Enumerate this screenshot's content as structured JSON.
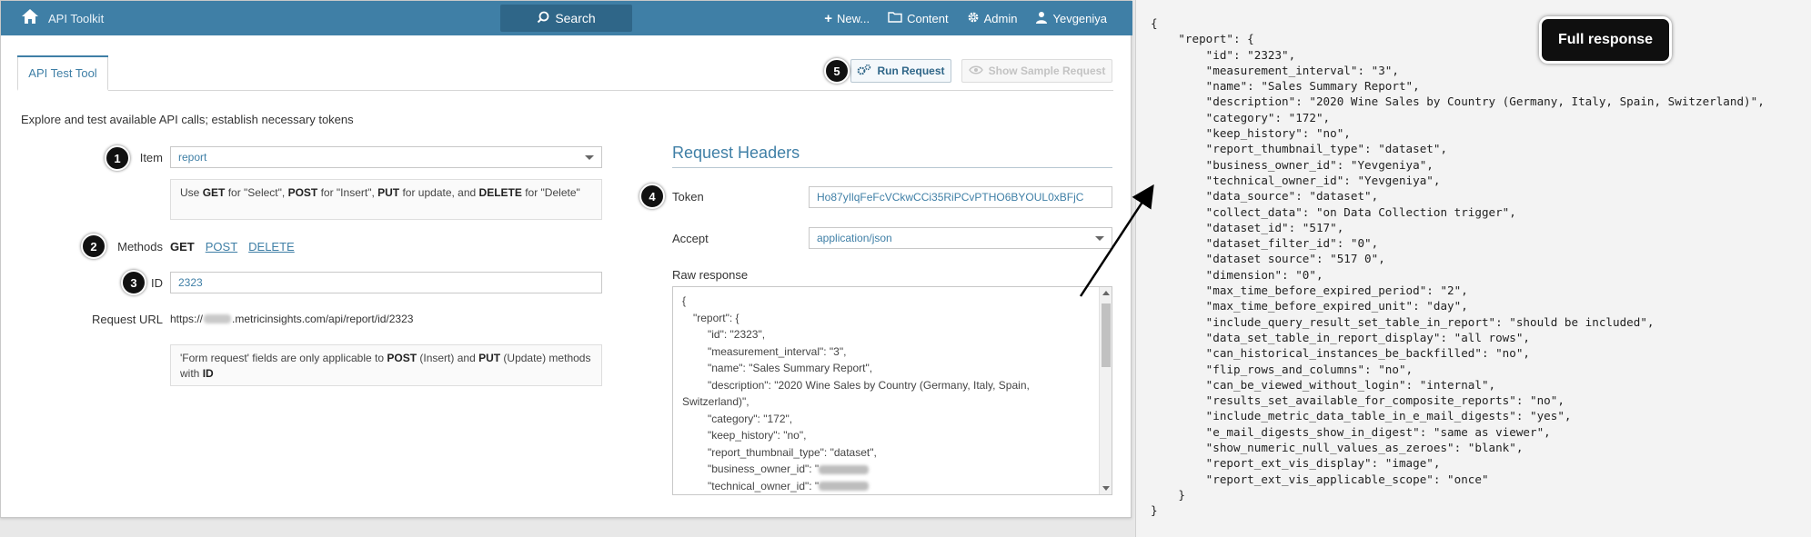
{
  "topbar": {
    "title": "API Toolkit",
    "search_label": "Search",
    "nav": [
      {
        "label": "New..."
      },
      {
        "label": "Content"
      },
      {
        "label": "Admin"
      },
      {
        "label": "Yevgeniya"
      }
    ]
  },
  "tab": {
    "label": "API Test Tool"
  },
  "actions": {
    "run_label": "Run Request",
    "sample_label": "Show Sample Request"
  },
  "intro": "Explore and test available API calls; establish necessary tokens",
  "form": {
    "item_label": "Item",
    "item_value": "report",
    "item_hint_parts": [
      "Use ",
      "GET",
      " for \"Select\", ",
      "POST",
      " for \"Insert\", ",
      "PUT",
      " for update, and ",
      "DELETE",
      " for \"Delete\""
    ],
    "methods_label": "Methods",
    "methods": [
      {
        "label": "GET",
        "active": true
      },
      {
        "label": "POST",
        "active": false
      },
      {
        "label": "DELETE",
        "active": false
      }
    ],
    "id_label": "ID",
    "id_value": "2323",
    "url_label": "Request URL",
    "url_prefix": "https://",
    "url_suffix": ".metricinsights.com/api/report/id/2323",
    "form_hint_parts": [
      "'Form request' fields are only applicable to ",
      "POST",
      " (Insert) and ",
      "PUT",
      " (Update) methods with ",
      "ID"
    ]
  },
  "headers": {
    "title": "Request Headers",
    "token_label": "Token",
    "token_value": "Ho87yIlqFeFcVCkwCCi35RiPCvPTHO6BYOUL0xBFjC",
    "accept_label": "Accept",
    "accept_value": "application/json",
    "raw_label": "Raw response"
  },
  "raw_response": [
    "{",
    "\"report\": {",
    "\"id\": \"2323\",",
    "\"measurement_interval\": \"3\",",
    "\"name\": \"Sales Summary Report\",",
    "\"description\": \"2020 Wine Sales by Country (Germany, Italy, Spain,",
    "Switzerland)\",",
    "\"category\": \"172\",",
    "\"keep_history\": \"no\",",
    "\"report_thumbnail_type\": \"dataset\",",
    "\"business_owner_id\": \"",
    "\"technical_owner_id\": \""
  ],
  "badges": [
    "1",
    "2",
    "3",
    "4",
    "5"
  ],
  "full_response_label": "Full response",
  "full_response_lines": [
    "{",
    "    \"report\": {",
    "        \"id\": \"2323\",",
    "        \"measurement_interval\": \"3\",",
    "        \"name\": \"Sales Summary Report\",",
    "        \"description\": \"2020 Wine Sales by Country (Germany, Italy, Spain, Switzerland)\",",
    "        \"category\": \"172\",",
    "        \"keep_history\": \"no\",",
    "        \"report_thumbnail_type\": \"dataset\",",
    "        \"business_owner_id\": \"Yevgeniya\",",
    "        \"technical_owner_id\": \"Yevgeniya\",",
    "        \"data_source\": \"dataset\",",
    "        \"collect_data\": \"on Data Collection trigger\",",
    "        \"dataset_id\": \"517\",",
    "        \"dataset_filter_id\": \"0\",",
    "        \"dataset source\": \"517 0\",",
    "        \"dimension\": \"0\",",
    "        \"max_time_before_expired_period\": \"2\",",
    "        \"max_time_before_expired_unit\": \"day\",",
    "        \"include_query_result_set_table_in_report\": \"should be included\",",
    "        \"data_set_table_in_report_display\": \"all rows\",",
    "        \"can_historical_instances_be_backfilled\": \"no\",",
    "        \"flip_rows_and_columns\": \"no\",",
    "        \"can_be_viewed_without_login\": \"internal\",",
    "        \"results_set_available_for_composite_reports\": \"no\",",
    "        \"include_metric_data_table_in_e_mail_digests\": \"yes\",",
    "        \"e_mail_digests_show_in_digest\": \"same as viewer\",",
    "        \"show_numeric_null_values_as_zeroes\": \"blank\",",
    "        \"report_ext_vis_display\": \"image\",",
    "        \"report_ext_vis_applicable_scope\": \"once\"",
    "    }",
    "}"
  ],
  "colors": {
    "brand": "#3f7fa6",
    "badge": "#111111"
  }
}
